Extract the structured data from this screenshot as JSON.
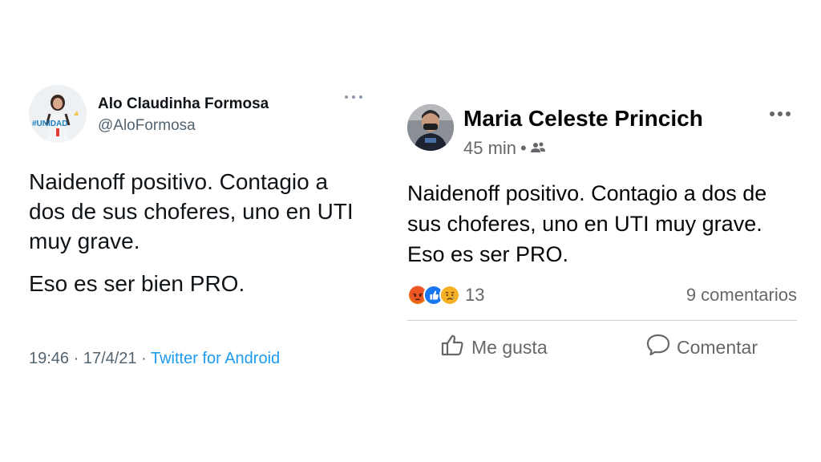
{
  "twitter": {
    "name": "Alo Claudinha Formosa",
    "handle": "@AloFormosa",
    "avatar_badge": "#UNIDAD",
    "icon": "more-horizontal-icon",
    "text_lines": [
      "Naidenoff positivo. Contagio a dos de sus choferes, uno en UTI muy grave.",
      "Eso es ser bien PRO."
    ],
    "time_date": "19:46 · 17/4/21 · ",
    "source": "Twitter for Android",
    "colors": {
      "source": "#1d9bf0",
      "secondary": "#536471"
    }
  },
  "facebook": {
    "name": "Maria Celeste Princich",
    "time": "45 min",
    "separator": "•",
    "audience_icon": "friends-icon",
    "text": "Naidenoff positivo. Contagio a dos de sus choferes, uno en UTI muy grave. Eso es ser PRO.",
    "reactions": [
      "angry-icon",
      "like-icon",
      "sad-icon"
    ],
    "reaction_count": "13",
    "comments": "9 comentarios",
    "like_label": "Me gusta",
    "comment_label": "Comentar",
    "colors": {
      "secondary": "#65676b",
      "like": "#1877f2",
      "angry": "#e9710f",
      "sad": "#f7b125"
    }
  }
}
